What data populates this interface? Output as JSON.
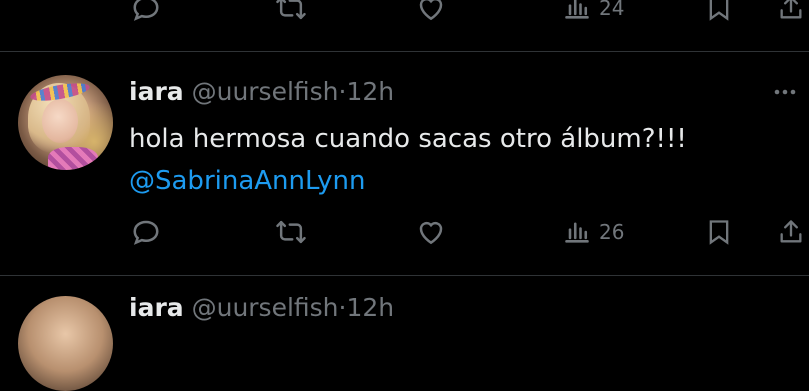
{
  "previous_tweet": {
    "views_count": "24"
  },
  "tweet": {
    "display_name": "iara",
    "handle": "@uurselfish",
    "separator": "·",
    "time": "12h",
    "text": "hola hermosa cuando sacas otro álbum?!!!",
    "mention": "@SabrinaAnnLynn",
    "views_count": "26"
  },
  "next_tweet": {
    "display_name": "iara",
    "handle": "@uurselfish",
    "separator": "·",
    "time": "12h"
  },
  "colors": {
    "background": "#000000",
    "primary_text": "#e7e9ea",
    "secondary_text": "#71767b",
    "link": "#1d9bf0",
    "divider": "#2f3336"
  },
  "icons": [
    "reply-icon",
    "retweet-icon",
    "like-icon",
    "views-icon",
    "bookmark-icon",
    "share-icon",
    "more-icon"
  ]
}
